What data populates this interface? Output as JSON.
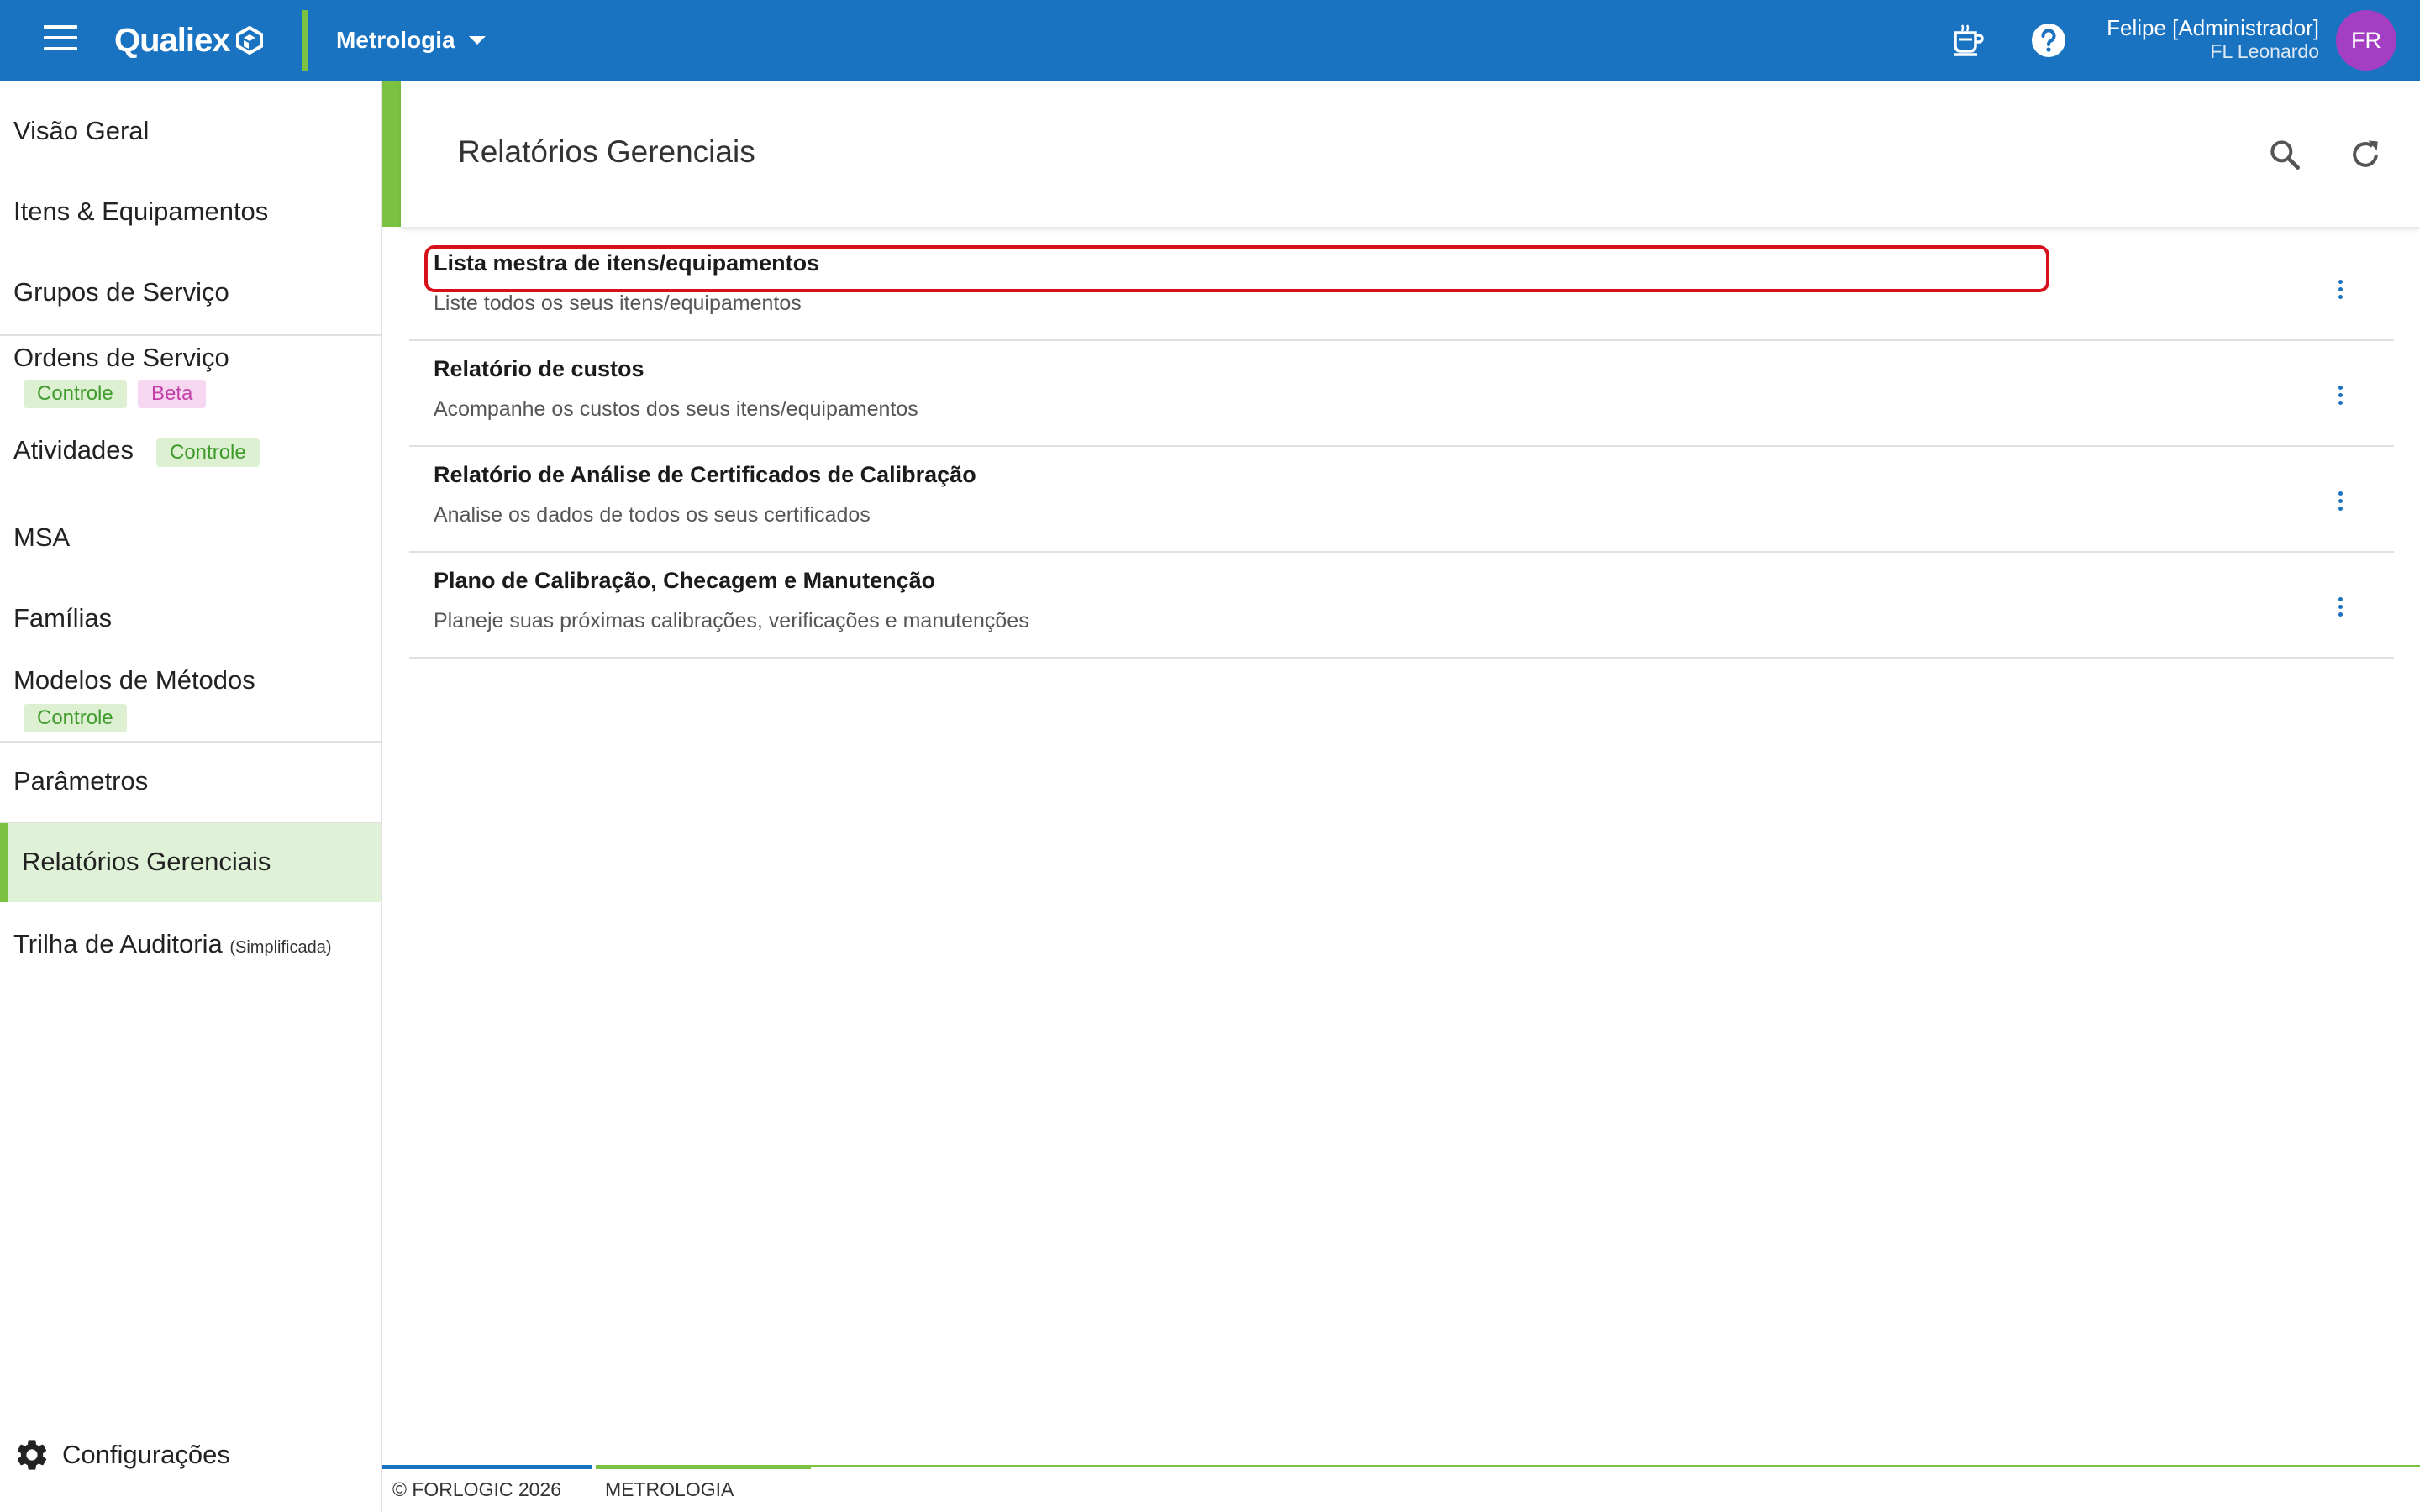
{
  "topbar": {
    "logo_text": "Qualiex",
    "module": "Metrologia",
    "user_name": "Felipe [Administrador]",
    "user_org": "FL Leonardo",
    "avatar_initials": "FR",
    "brand_color": "#1a73c0",
    "accent_color": "#7cc242",
    "avatar_color": "#a43ec2"
  },
  "sidebar": {
    "items": [
      {
        "label": "Visão Geral"
      },
      {
        "label": "Itens & Equipamentos"
      },
      {
        "label": "Grupos de Serviço"
      },
      {
        "label": "Ordens de Serviço",
        "tags": [
          "Controle",
          "Beta"
        ]
      },
      {
        "label": "Atividades",
        "tags": [
          "Controle"
        ]
      },
      {
        "label": "MSA"
      },
      {
        "label": "Famílias"
      },
      {
        "label": "Modelos de Métodos",
        "tags": [
          "Controle"
        ]
      },
      {
        "label": "Parâmetros"
      },
      {
        "label": "Relatórios Gerenciais",
        "active": true
      },
      {
        "label": "Trilha de Auditoria",
        "note": "(Simplificada)"
      }
    ],
    "settings_label": "Configurações"
  },
  "page": {
    "title": "Relatórios Gerenciais"
  },
  "reports": [
    {
      "title": "Lista mestra de itens/equipamentos",
      "description": "Liste todos os seus itens/equipamentos",
      "highlighted": true
    },
    {
      "title": "Relatório de custos",
      "description": "Acompanhe os custos dos seus itens/equipamentos"
    },
    {
      "title": "Relatório de Análise de Certificados de Calibração",
      "description": "Analise os dados de todos os seus certificados"
    },
    {
      "title": "Plano de Calibração, Checagem e Manutenção",
      "description": "Planeje suas próximas calibrações, verificações e manutenções"
    }
  ],
  "footer": {
    "copyright": "© FORLOGIC 2026",
    "module": "METROLOGIA"
  }
}
